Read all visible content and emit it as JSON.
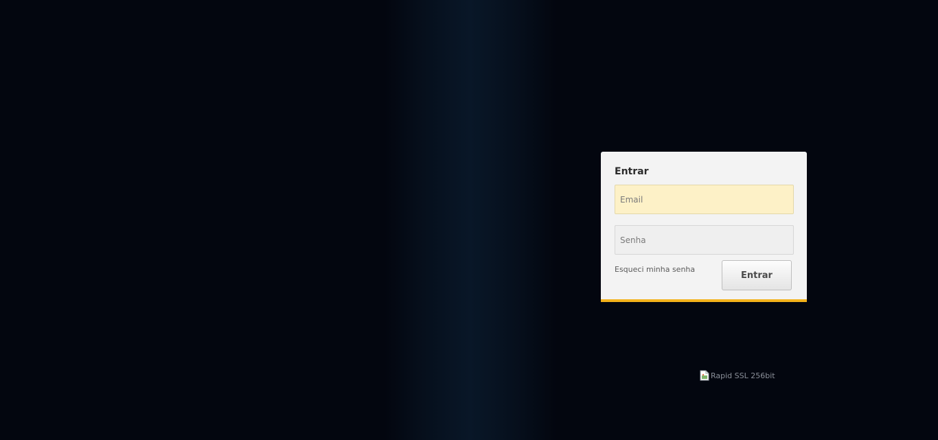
{
  "login": {
    "title": "Entrar",
    "email_placeholder": "Email",
    "password_placeholder": "Senha",
    "forgot_password_label": "Esqueci minha senha",
    "submit_label": "Entrar"
  },
  "ssl_badge": {
    "alt_text": "Rapid SSL 256bit",
    "icon": "broken-image-icon"
  },
  "colors": {
    "background": "#03060f",
    "card": "#f3f3f3",
    "accent": "#f3b21b",
    "email_field_autofill": "#fdf1c7"
  }
}
